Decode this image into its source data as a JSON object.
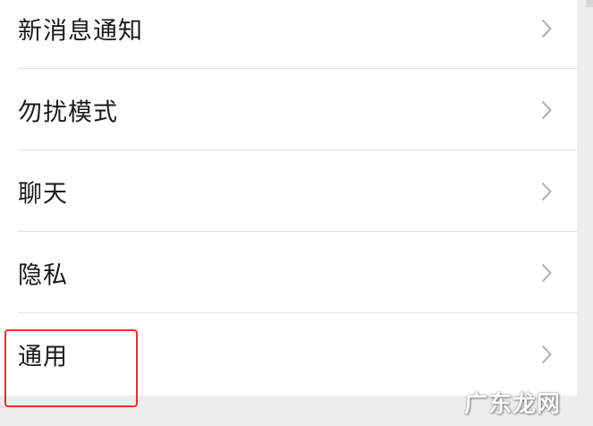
{
  "settings_list": {
    "items": [
      {
        "label": "新消息通知"
      },
      {
        "label": "勿扰模式"
      },
      {
        "label": "聊天"
      },
      {
        "label": "隐私"
      },
      {
        "label": "通用"
      }
    ]
  },
  "annotation": {
    "highlight_color": "#e0313a",
    "highlighted_item": "通用"
  },
  "watermark": {
    "text": "广东龙网"
  },
  "icons": {
    "chevron": "chevron-right-icon"
  }
}
